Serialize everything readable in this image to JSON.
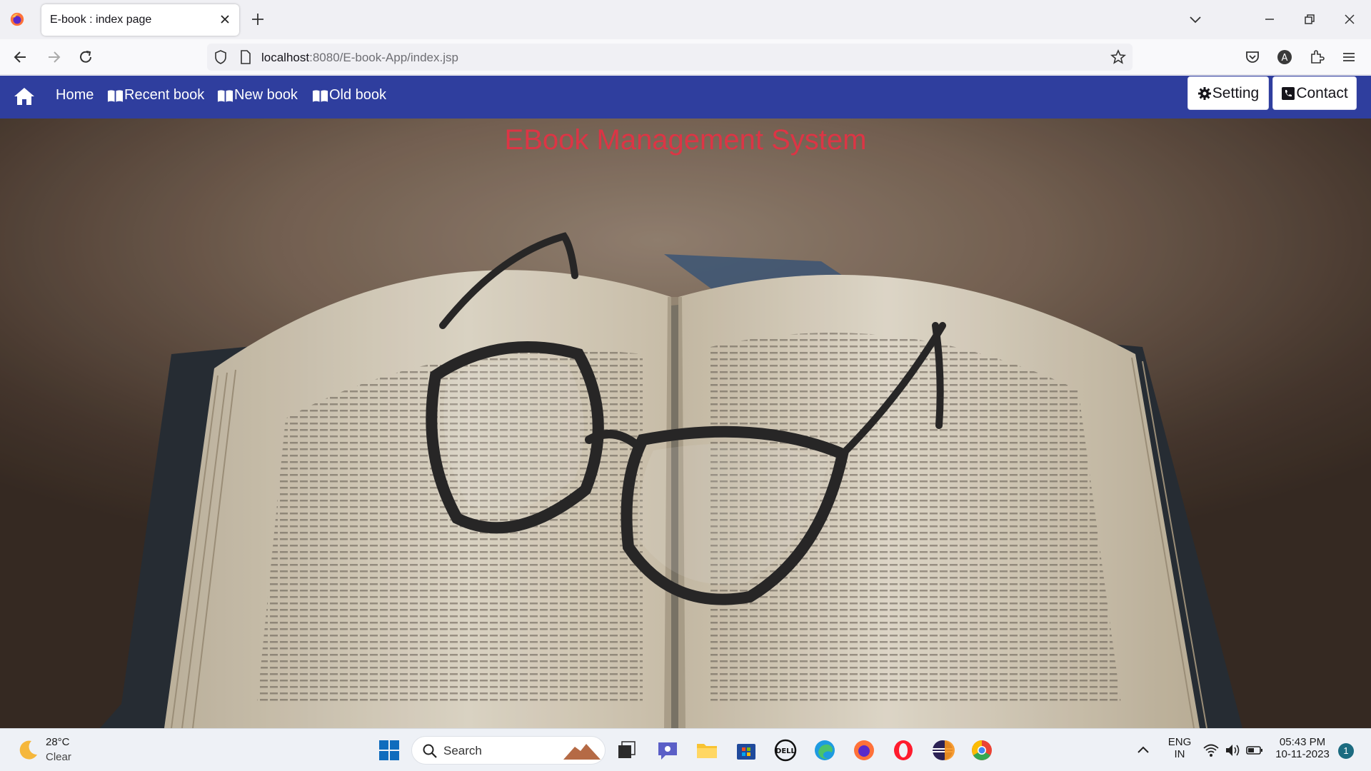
{
  "browser": {
    "tab_title": "E-book : index page",
    "url_host": "localhost",
    "url_rest": ":8080/E-book-App/index.jsp"
  },
  "navbar": {
    "links": [
      "Home",
      "Recent book",
      "New book",
      "Old book"
    ],
    "setting_label": "Setting",
    "contact_label": "Contact",
    "bg_color": "#2f3e9e"
  },
  "hero": {
    "title": "EBook Management System",
    "title_color": "#dc3545"
  },
  "taskbar": {
    "temperature": "28°C",
    "condition": "Clear",
    "search_label": "Search",
    "lang_1": "ENG",
    "lang_2": "IN",
    "time": "05:43 PM",
    "date": "10-11-2023",
    "notification_count": "1"
  }
}
